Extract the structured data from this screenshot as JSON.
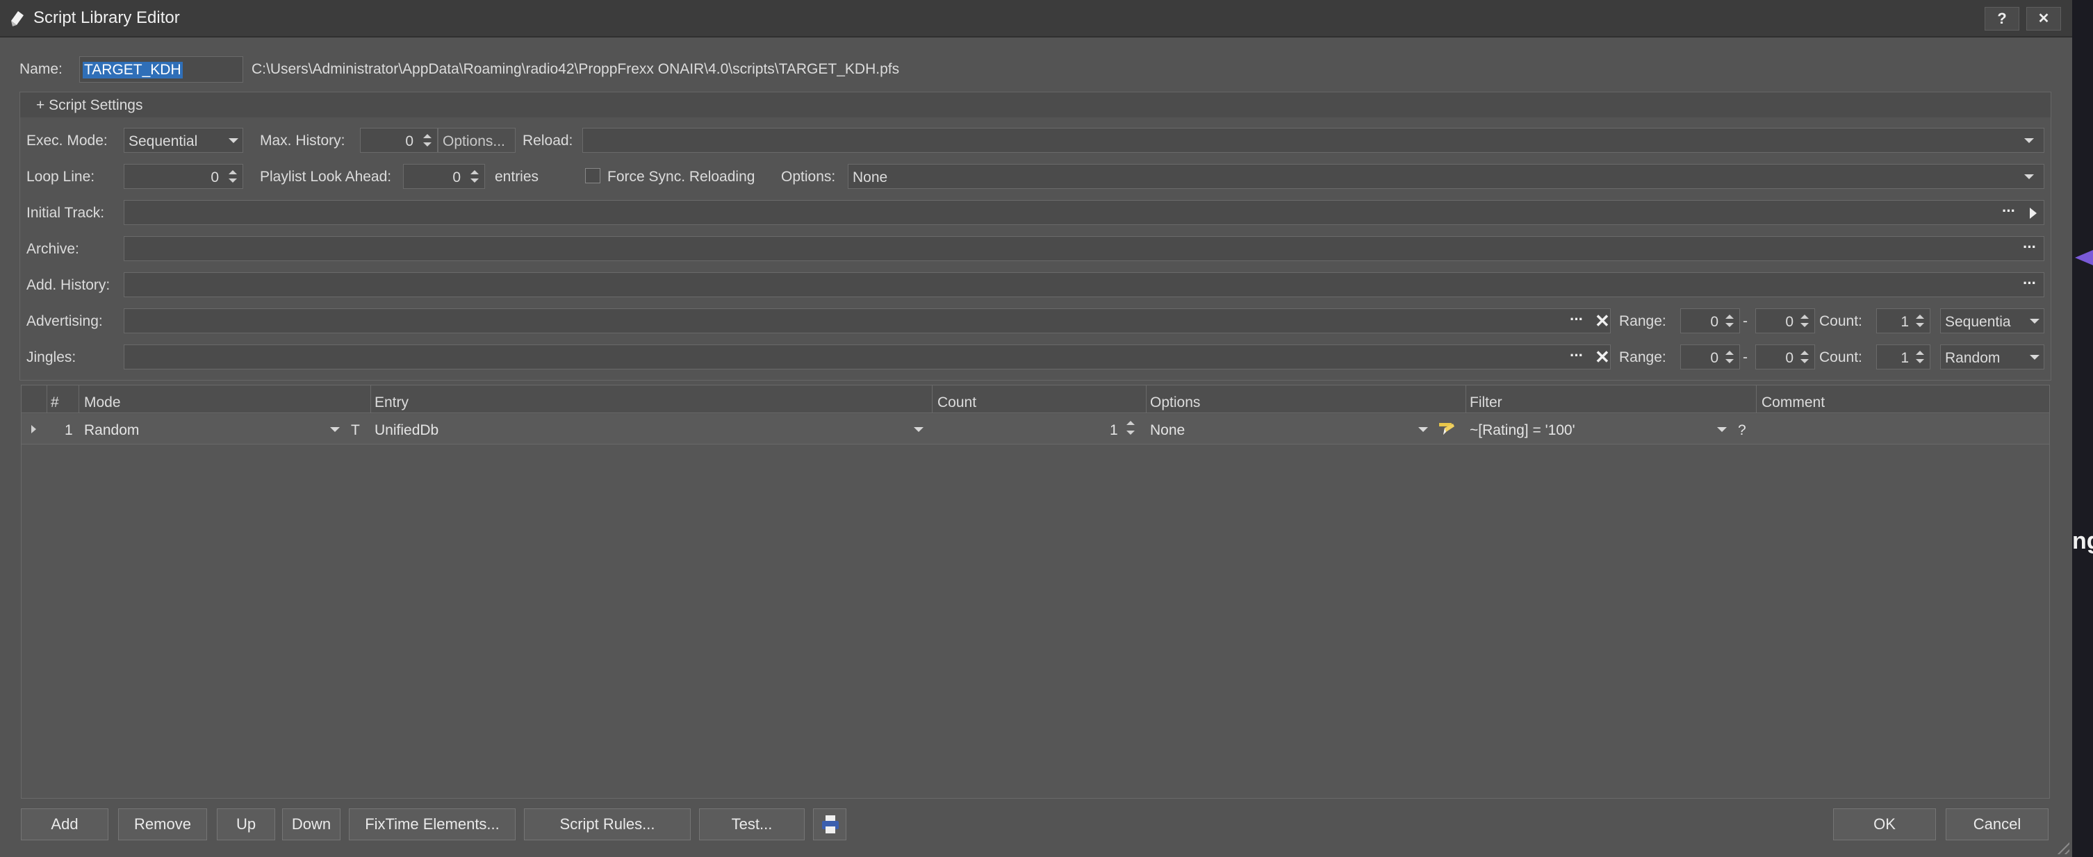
{
  "window": {
    "title": "Script Library Editor",
    "help_label": "?",
    "close_label": "✕"
  },
  "name_row": {
    "label": "Name:",
    "value": "TARGET_KDH",
    "path": "C:\\Users\\Administrator\\AppData\\Roaming\\radio42\\ProppFrexx ONAIR\\4.0\\scripts\\TARGET_KDH.pfs"
  },
  "script_settings": {
    "toggle_label": "+ Script Settings",
    "exec_mode": {
      "label": "Exec. Mode:",
      "value": "Sequential"
    },
    "max_history": {
      "label": "Max. History:",
      "value": "0",
      "options_label": "Options..."
    },
    "reload": {
      "label": "Reload:",
      "value": ""
    },
    "loop_line": {
      "label": "Loop Line:",
      "value": "0"
    },
    "playlist_look_ahead": {
      "label": "Playlist Look Ahead:",
      "value": "0",
      "suffix": "entries"
    },
    "force_sync": {
      "label": "Force Sync. Reloading",
      "checked": false
    },
    "options": {
      "label": "Options:",
      "value": "None"
    },
    "initial_track": {
      "label": "Initial Track:",
      "value": ""
    },
    "archive": {
      "label": "Archive:",
      "value": ""
    },
    "add_history": {
      "label": "Add. History:",
      "value": ""
    },
    "advertising": {
      "label": "Advertising:",
      "value": "",
      "range_label": "Range:",
      "range_from": "0",
      "range_sep": "-",
      "range_to": "0",
      "count_label": "Count:",
      "count": "1",
      "mode": "Sequentia"
    },
    "jingles": {
      "label": "Jingles:",
      "value": "",
      "range_label": "Range:",
      "range_from": "0",
      "range_sep": "-",
      "range_to": "0",
      "count_label": "Count:",
      "count": "1",
      "mode": "Random"
    }
  },
  "grid": {
    "columns": [
      "#",
      "Mode",
      "Entry",
      "Count",
      "Options",
      "Filter",
      "Comment"
    ],
    "rows": [
      {
        "num": "1",
        "mode": "Random",
        "type_flag": "T",
        "entry": "UnifiedDb",
        "count": "1",
        "options": "None",
        "filter": "~[Rating] = '100'",
        "comment": "",
        "filter_help": "?"
      }
    ]
  },
  "buttons": {
    "add": "Add",
    "remove": "Remove",
    "up": "Up",
    "down": "Down",
    "fixtime": "FixTime Elements...",
    "script_rules": "Script Rules...",
    "test": "Test...",
    "ok": "OK",
    "cancel": "Cancel"
  },
  "background_app": {
    "partial_text": "ng"
  },
  "icons": {
    "app": "script-icon",
    "dropdown": "chevron-down-icon",
    "spinner": "spinner-icon",
    "browse": "more-icon",
    "clear": "close-icon",
    "play": "play-icon",
    "options_edit": "edit-icon",
    "print": "print-icon",
    "expand": "expand-row-icon"
  },
  "colors": {
    "selection": "#2f6fb8",
    "window_bg": "#545454",
    "titlebar_bg": "#3c3c3c"
  }
}
